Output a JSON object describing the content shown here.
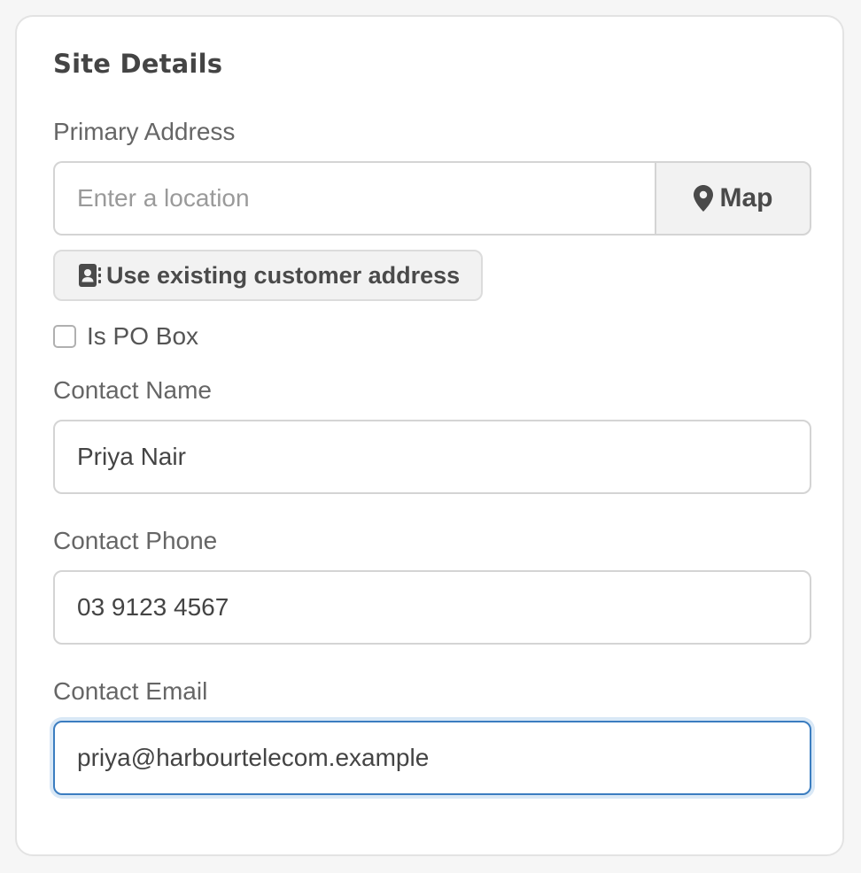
{
  "section": {
    "title": "Site Details"
  },
  "primary_address": {
    "label": "Primary Address",
    "placeholder": "Enter a location",
    "value": "",
    "map_button_label": "Map",
    "map_icon": "map-marker-icon"
  },
  "existing_address_button": {
    "label": "Use existing customer address",
    "icon": "address-book-icon"
  },
  "po_box": {
    "label": "Is PO Box",
    "checked": false
  },
  "contact_name": {
    "label": "Contact Name",
    "value": "Priya Nair"
  },
  "contact_phone": {
    "label": "Contact Phone",
    "value": "03 9123 4567"
  },
  "contact_email": {
    "label": "Contact Email",
    "value": "priya@harbourtelecom.example"
  },
  "colors": {
    "focus_border": "#3b7dc0",
    "focus_ring": "#d9e8f6"
  }
}
